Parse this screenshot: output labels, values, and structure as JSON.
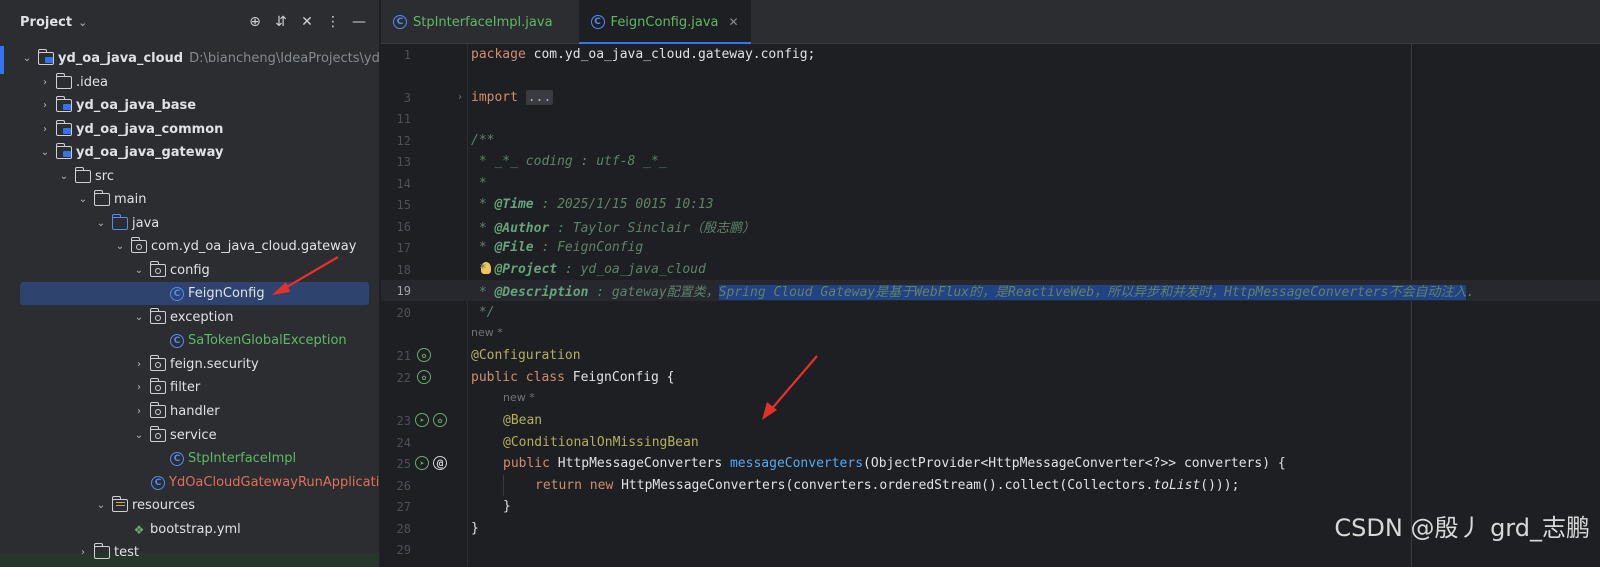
{
  "project_panel": {
    "title": "Project",
    "tree": [
      {
        "label": "yd_oa_java_cloud",
        "path": "D:\\biancheng\\IdeaProjects\\yd_oa_j"
      },
      {
        "label": ".idea"
      },
      {
        "label": "yd_oa_java_base"
      },
      {
        "label": "yd_oa_java_common"
      },
      {
        "label": "yd_oa_java_gateway"
      },
      {
        "label": "src"
      },
      {
        "label": "main"
      },
      {
        "label": "java"
      },
      {
        "label": "com.yd_oa_java_cloud.gateway"
      },
      {
        "label": "config"
      },
      {
        "label": "FeignConfig"
      },
      {
        "label": "exception"
      },
      {
        "label": "SaTokenGlobalException"
      },
      {
        "label": "feign.security"
      },
      {
        "label": "filter"
      },
      {
        "label": "handler"
      },
      {
        "label": "service"
      },
      {
        "label": "StpInterfaceImpl"
      },
      {
        "label": "YdOaCloudGatewayRunApplication"
      },
      {
        "label": "resources"
      },
      {
        "label": "bootstrap.yml"
      },
      {
        "label": "test"
      }
    ]
  },
  "tabs": [
    {
      "label": "StpInterfaceImpl.java",
      "active": false
    },
    {
      "label": "FeignConfig.java",
      "active": true
    }
  ],
  "editor": {
    "line_numbers": [
      "1",
      "",
      "3",
      "11",
      "12",
      "13",
      "14",
      "15",
      "16",
      "17",
      "18",
      "19",
      "20",
      "21",
      "22",
      "23",
      "24",
      "25",
      "26",
      "27",
      "28",
      "29"
    ],
    "package_kw": "package",
    "package_name": "com.yd_oa_java_cloud.gateway.config;",
    "import_kw": "import",
    "import_fold": "...",
    "c_open": "/**",
    "c_coding": " * _*_ coding : utf-8 _*_",
    "c_star": " *",
    "c_time_tag": "@Time",
    "c_time_val": " : 2025/1/15 0015 10:13",
    "c_author_tag": "@Author",
    "c_author_val": " : Taylor Sinclair（殷志鹏）",
    "c_file_tag": "@File",
    "c_file_val": " : FeignConfig",
    "c_project_tag": "@Project",
    "c_project_val": " : yd_oa_java_cloud",
    "c_desc_tag": "@Description",
    "c_desc_plain": " : gateway配置类，",
    "c_desc_sel": "Spring Cloud Gateway是基于WebFlux的，是ReactiveWeb，所以异步和并发时，HttpMessageConverters不会自动注入",
    "c_desc_end": ".",
    "c_close": " */",
    "hint_new": "new *",
    "ann_configuration": "@Configuration",
    "class_kw": "public class ",
    "class_name": "FeignConfig {",
    "ann_bean": "@Bean",
    "ann_cond": "@ConditionalOnMissingBean",
    "method_kw": "public ",
    "method_type": "HttpMessageConverters ",
    "method_name": "messageConverters",
    "method_params": "(ObjectProvider<HttpMessageConverter<?>> converters) {",
    "return_kw": "return new ",
    "return_expr_a": "HttpMessageConverters(converters.orderedStream().collect(Collectors.",
    "return_expr_tolist": "toList",
    "return_expr_b": "()));",
    "close_method": "}",
    "close_class": "}"
  },
  "watermark": "CSDN @殷丿 grd_志鹏"
}
